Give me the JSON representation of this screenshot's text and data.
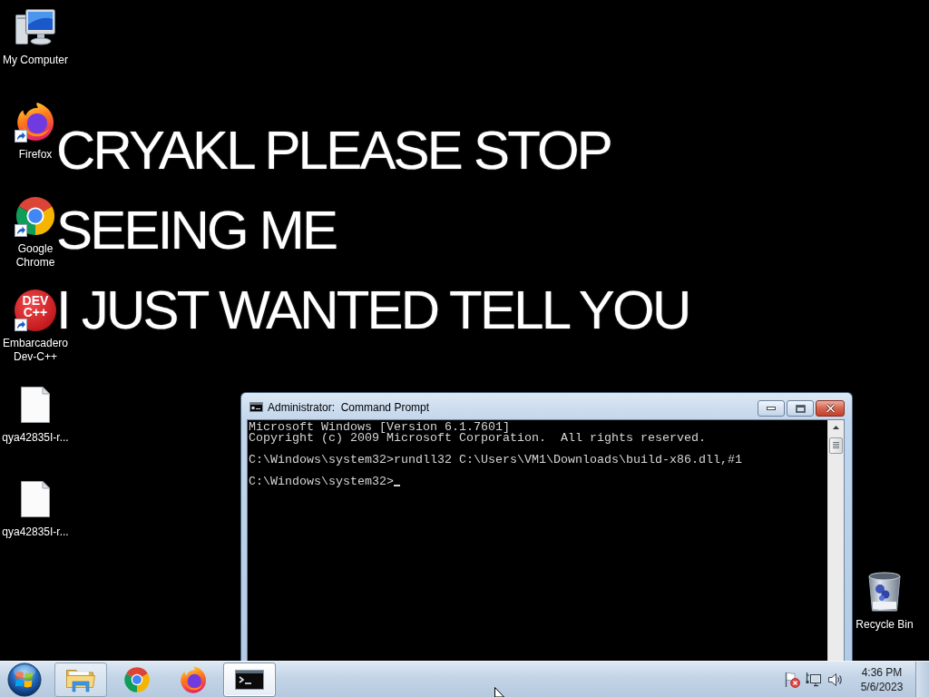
{
  "desktop": {
    "wallpaper_text": [
      "CRYAKL PLEASE STOP",
      "SEEING ME",
      "I JUST WANTED TELL YOU"
    ],
    "icons": [
      {
        "kind": "computer",
        "label": "My Computer",
        "shortcut": false
      },
      {
        "kind": "firefox",
        "label": "Firefox",
        "shortcut": true
      },
      {
        "kind": "chrome",
        "label": "Google Chrome",
        "shortcut": true
      },
      {
        "kind": "devcpp",
        "label": "Embarcadero Dev-C++",
        "shortcut": true,
        "logo_text": [
          "DEV",
          "C++"
        ]
      },
      {
        "kind": "file",
        "label": "qya42835I-r...",
        "shortcut": false
      },
      {
        "kind": "file",
        "label": "qya42835I-r...",
        "shortcut": false
      }
    ],
    "recycle_bin": {
      "label": "Recycle Bin"
    }
  },
  "window": {
    "title": "Administrator:  Command Prompt",
    "console": [
      {
        "lines": [
          "Microsoft Windows [Version 6.1.7601]",
          "Copyright (c) 2009 Microsoft Corporation.  All rights reserved."
        ]
      },
      {
        "lines": [
          "C:\\Windows\\system32>rundll32 C:\\Users\\VM1\\Downloads\\build-x86.dll,#1"
        ]
      },
      {
        "lines": [
          "C:\\Windows\\system32>"
        ]
      }
    ],
    "cursor": true
  },
  "taskbar": {
    "items": [
      {
        "kind": "explorer",
        "running": true,
        "selected": false
      },
      {
        "kind": "chrome",
        "running": false,
        "selected": false
      },
      {
        "kind": "firefox",
        "running": false,
        "selected": false
      },
      {
        "kind": "cmd",
        "running": true,
        "selected": true
      }
    ],
    "tray_icons": [
      {
        "kind": "flag"
      },
      {
        "kind": "network"
      },
      {
        "kind": "volume"
      }
    ],
    "clock": {
      "time": "4:36 PM",
      "date": "5/6/2023"
    }
  }
}
